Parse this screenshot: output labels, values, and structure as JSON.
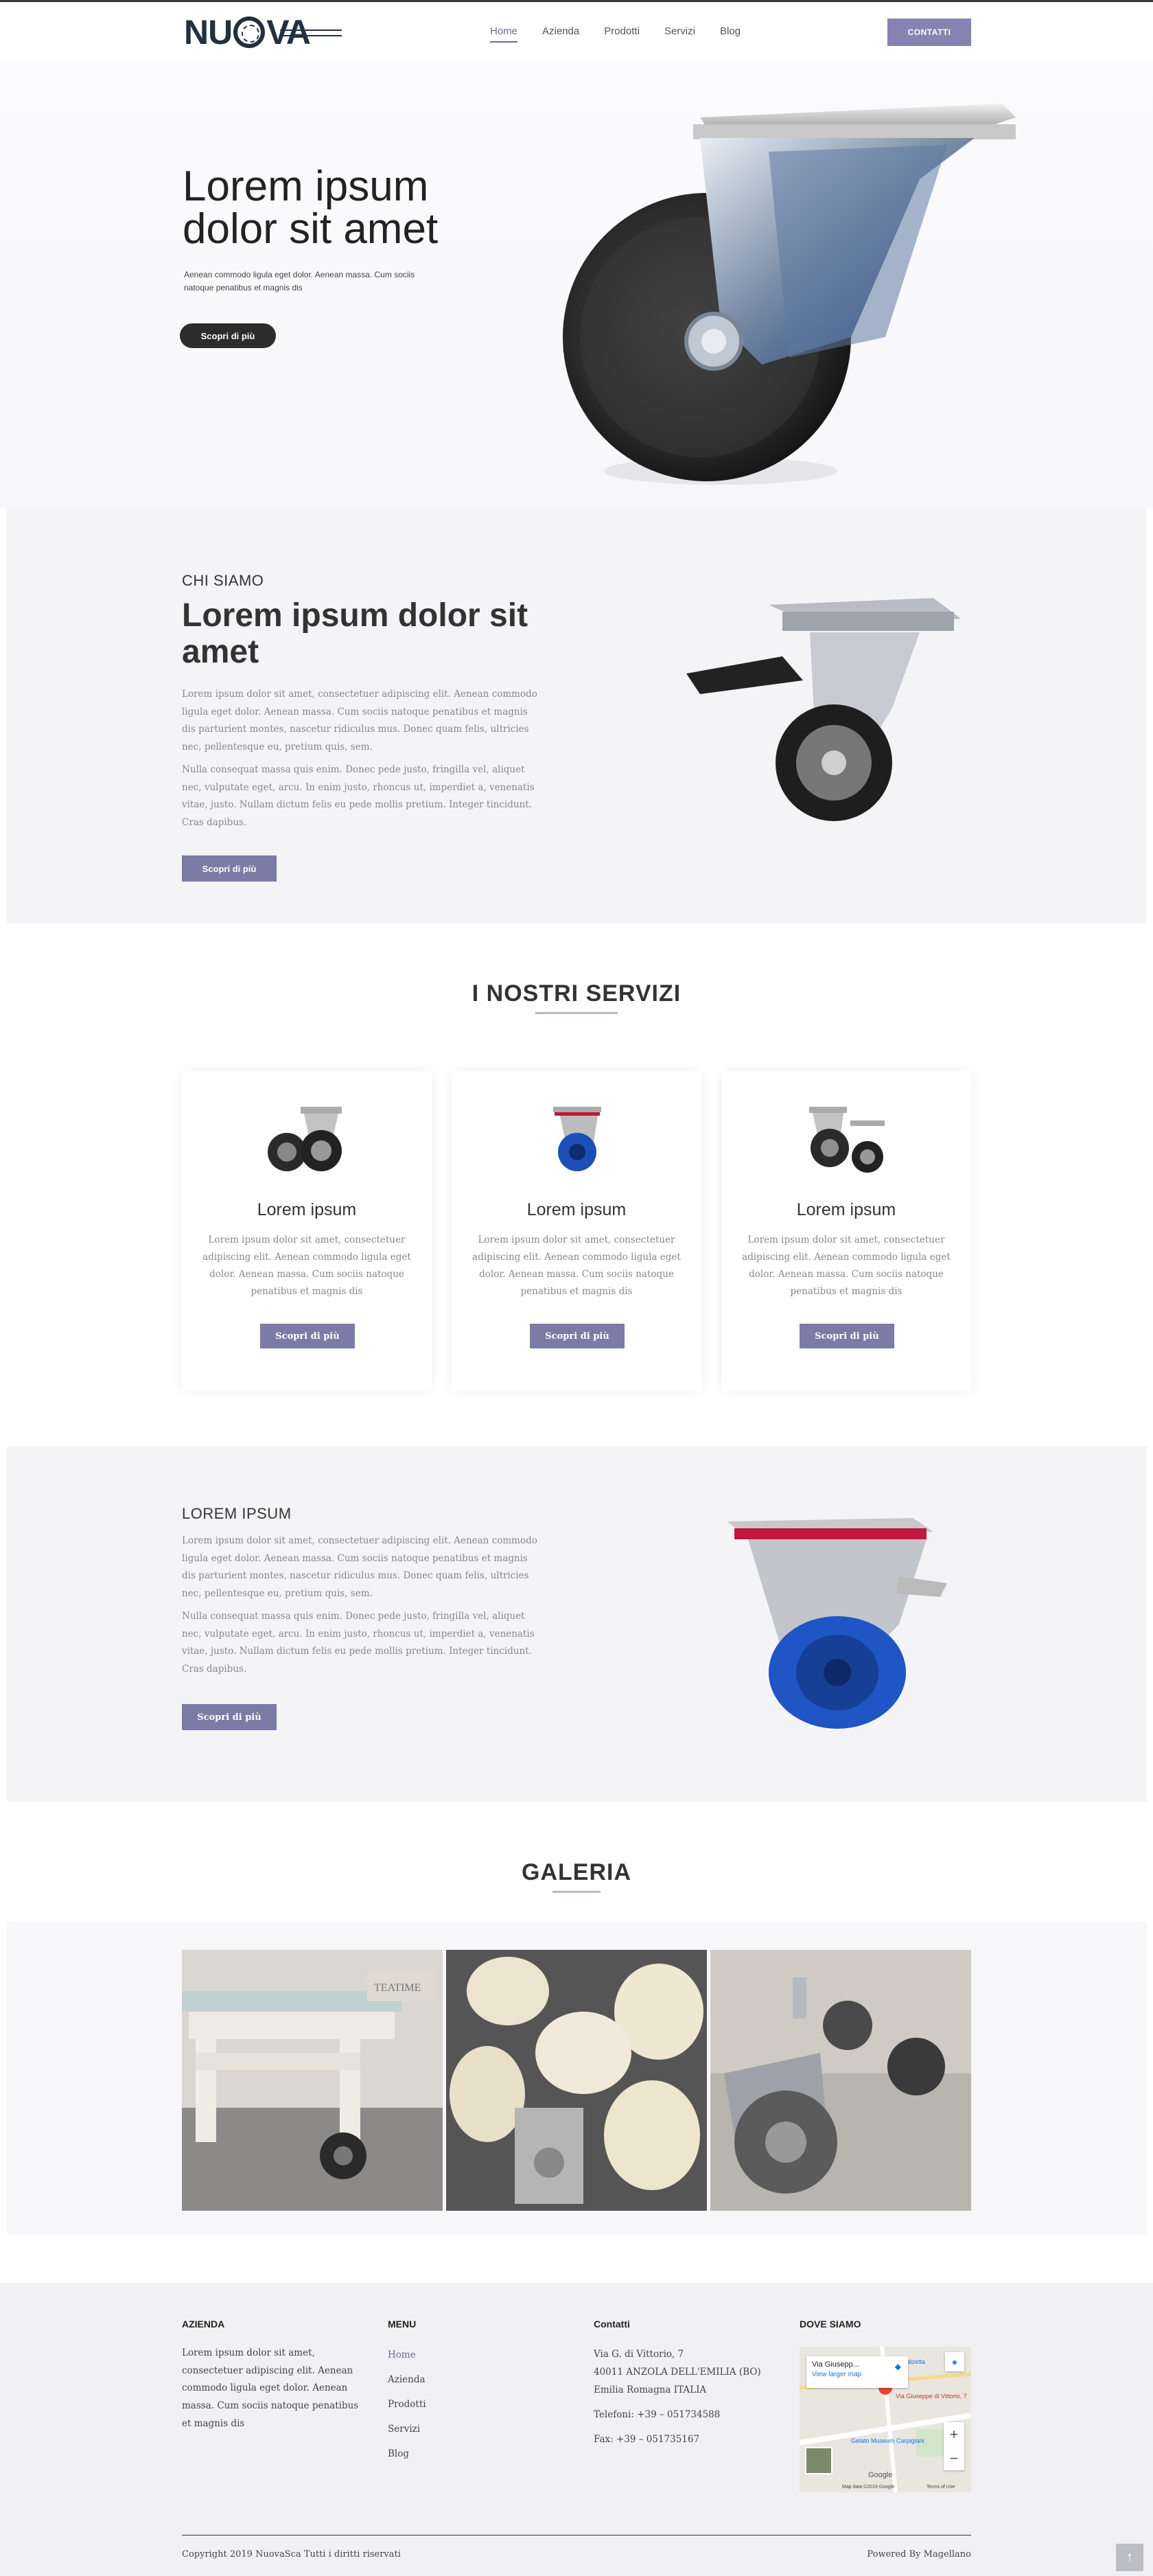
{
  "header": {
    "logo_text_left": "NU",
    "logo_text_right": "VA",
    "nav": [
      "Home",
      "Azienda",
      "Prodotti",
      "Servizi",
      "Blog"
    ],
    "contact_button": "CONTATTI"
  },
  "hero": {
    "title": "Lorem ipsum dolor sit amet",
    "text": "Aenean commodo ligula eget dolor. Aenean massa. Cum sociis natoque penatibus et magnis dis",
    "button": "Scopri di più"
  },
  "about": {
    "eyebrow": "CHI SIAMO",
    "title": "Lorem ipsum dolor sit amet",
    "para1": "Lorem ipsum dolor sit amet, consectetuer adipiscing elit. Aenean commodo ligula eget dolor. Aenean massa. Cum sociis natoque penatibus et magnis dis parturient montes, nascetur ridiculus mus. Donec quam felis, ultricies nec, pellentesque eu, pretium quis, sem.",
    "para2": "Nulla consequat massa quis enim. Donec pede justo, fringilla vel, aliquet nec, vulputate eget, arcu. In enim justo, rhoncus ut, imperdiet a, venenatis vitae, justo. Nullam dictum felis eu pede mollis pretium. Integer tincidunt. Cras dapibus.",
    "button": "Scopri di più"
  },
  "services": {
    "title": "I NOSTRI SERVIZI",
    "cards": [
      {
        "title": "Lorem ipsum",
        "text": "Lorem ipsum dolor sit amet, consectetuer adipiscing elit. Aenean commodo ligula eget dolor. Aenean massa. Cum sociis natoque penatibus et magnis dis",
        "button": "Scopri di più"
      },
      {
        "title": "Lorem ipsum",
        "text": "Lorem ipsum dolor sit amet, consectetuer adipiscing elit. Aenean commodo ligula eget dolor. Aenean massa. Cum sociis natoque penatibus et magnis dis",
        "button": "Scopri di più"
      },
      {
        "title": "Lorem ipsum",
        "text": "Lorem ipsum dolor sit amet, consectetuer adipiscing elit. Aenean commodo ligula eget dolor. Aenean massa. Cum sociis natoque penatibus et magnis dis",
        "button": "Scopri di più"
      }
    ]
  },
  "lorem": {
    "eyebrow": "LOREM IPSUM",
    "para1": "Lorem ipsum dolor sit amet, consectetuer adipiscing elit. Aenean commodo ligula eget dolor. Aenean massa. Cum sociis natoque penatibus et magnis dis parturient montes, nascetur ridiculus mus. Donec quam felis, ultricies nec, pellentesque eu, pretium quis, sem.",
    "para2": "Nulla consequat massa quis enim. Donec pede justo, fringilla vel, aliquet nec, vulputate eget, arcu. In enim justo, rhoncus ut, imperdiet a, venenatis vitae, justo. Nullam dictum felis eu pede mollis pretium. Integer tincidunt. Cras dapibus.",
    "button": "Scopri di più"
  },
  "gallery": {
    "title": "GALERIA",
    "sign_text": "TEATIME"
  },
  "footer": {
    "azienda_head": "AZIENDA",
    "azienda_text": "Lorem ipsum dolor sit amet, consectetuer adipiscing elit. Aenean commodo ligula eget dolor. Aenean massa. Cum sociis natoque penatibus et magnis dis",
    "menu_head": "MENU",
    "menu": [
      "Home",
      "Azienda",
      "Prodotti",
      "Servizi",
      "Blog"
    ],
    "contatti_head": "Contatti",
    "address1": "Via G. di Vittorio, 7",
    "address2": "40011 ANZOLA DELL'EMILIA (BO)",
    "address3": "Emilia Romagna ITALIA",
    "phone": "Telefoni:  +39 – 051734588",
    "fax": "Fax:  +39 – 051735167",
    "dove_head": "DOVE SIAMO",
    "map_place": "Via Giusepp...",
    "map_larger": "View larger map",
    "map_pin_label": "Via Giuseppe di Vittorio, 7",
    "map_poi1": "Gelato Museum Carpigiani",
    "map_poi2": "Calzetta",
    "map_google": "Google",
    "map_data": "Map data ©2019 Google",
    "map_terms": "Terms of Use",
    "copyright": "Copyright 2019 NuovaSca Tutti i diritti riservati",
    "powered": "Powered By Magellano"
  },
  "colors": {
    "accent": "#7b7ba6",
    "dark": "#2c2c2c",
    "logo": "#23303f"
  }
}
